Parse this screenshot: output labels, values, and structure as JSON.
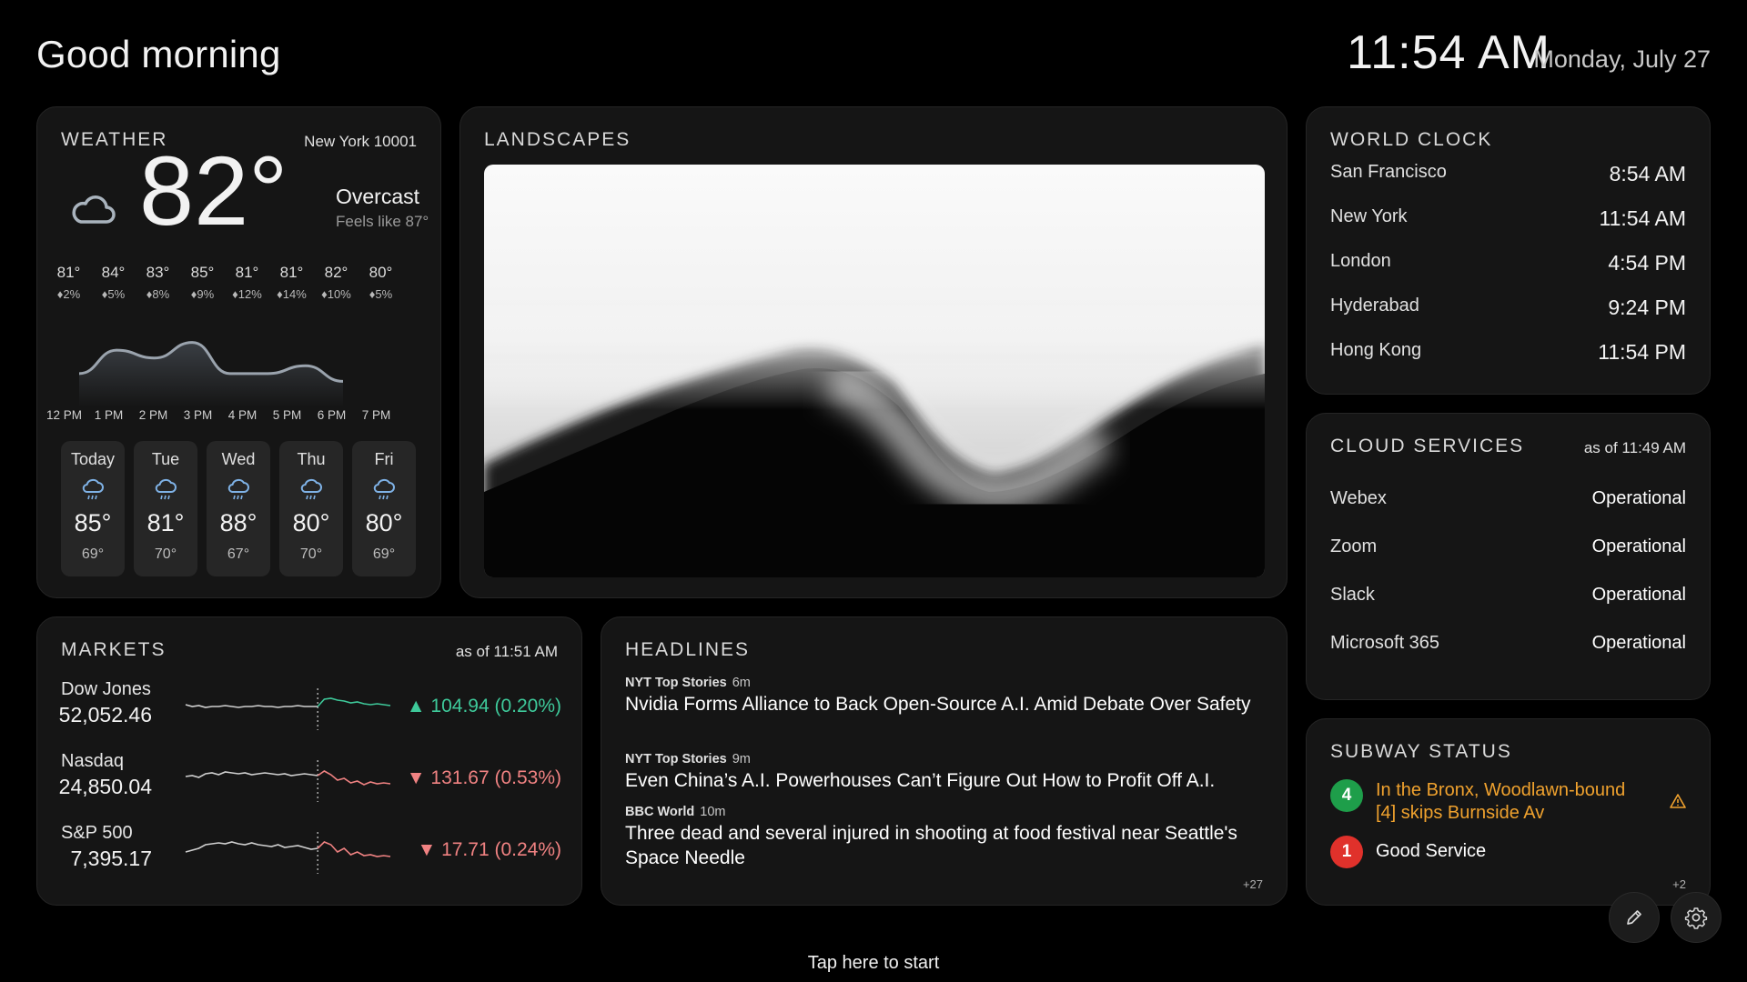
{
  "header": {
    "greeting": "Good morning",
    "time": "11:54 AM",
    "date": "Monday, July 27"
  },
  "weather": {
    "title": "WEATHER",
    "location": "New York 10001",
    "temp": "82°",
    "condition": "Overcast",
    "feels_like": "Feels like 87°",
    "icon": "cloud-icon",
    "hourly": [
      {
        "temp": "81°",
        "precip": "♦2%"
      },
      {
        "temp": "84°",
        "precip": "♦5%"
      },
      {
        "temp": "83°",
        "precip": "♦8%"
      },
      {
        "temp": "85°",
        "precip": "♦9%"
      },
      {
        "temp": "81°",
        "precip": "♦12%"
      },
      {
        "temp": "81°",
        "precip": "♦14%"
      },
      {
        "temp": "82°",
        "precip": "♦10%"
      },
      {
        "temp": "80°",
        "precip": "♦5%"
      }
    ],
    "hour_labels": [
      "12 PM",
      "1 PM",
      "2 PM",
      "3 PM",
      "4 PM",
      "5 PM",
      "6 PM",
      "7 PM"
    ],
    "daily": [
      {
        "name": "Today",
        "hi": "85°",
        "lo": "69°",
        "icon": "rain-icon"
      },
      {
        "name": "Tue",
        "hi": "81°",
        "lo": "70°",
        "icon": "rain-icon"
      },
      {
        "name": "Wed",
        "hi": "88°",
        "lo": "67°",
        "icon": "rain-icon"
      },
      {
        "name": "Thu",
        "hi": "80°",
        "lo": "70°",
        "icon": "rain-icon"
      },
      {
        "name": "Fri",
        "hi": "80°",
        "lo": "69°",
        "icon": "rain-icon"
      }
    ]
  },
  "landscapes": {
    "title": "LANDSCAPES"
  },
  "world_clock": {
    "title": "WORLD CLOCK",
    "cities": [
      {
        "city": "San Francisco",
        "time": "8:54 AM"
      },
      {
        "city": "New York",
        "time": "11:54 AM"
      },
      {
        "city": "London",
        "time": "4:54 PM"
      },
      {
        "city": "Hyderabad",
        "time": "9:24 PM"
      },
      {
        "city": "Hong Kong",
        "time": "11:54 PM"
      }
    ]
  },
  "cloud_services": {
    "title": "CLOUD SERVICES",
    "as_of": "as of 11:49 AM",
    "services": [
      {
        "name": "Webex",
        "status": "Operational"
      },
      {
        "name": "Zoom",
        "status": "Operational"
      },
      {
        "name": "Slack",
        "status": "Operational"
      },
      {
        "name": "Microsoft 365",
        "status": "Operational"
      }
    ]
  },
  "subway": {
    "title": "SUBWAY STATUS",
    "lines": [
      {
        "line": "4",
        "color": "#1e9e4a",
        "text_color": "#f0a22e",
        "status": "In the Bronx, Woodlawn-bound [4] skips Burnside Av",
        "warning": true
      },
      {
        "line": "1",
        "color": "#e0312b",
        "text_color": "#ffffff",
        "status": "Good Service",
        "warning": false
      }
    ],
    "more": "+2"
  },
  "markets": {
    "title": "MARKETS",
    "as_of": "as of 11:51 AM",
    "items": [
      {
        "name": "Dow Jones",
        "value": "52,052.46",
        "change": "▲ 104.94 (0.20%)",
        "direction": "up"
      },
      {
        "name": "Nasdaq",
        "value": "24,850.04",
        "change": "▼ 131.67 (0.53%)",
        "direction": "down"
      },
      {
        "name": "S&P 500",
        "value": "7,395.17",
        "change": "▼ 17.71 (0.24%)",
        "direction": "down"
      }
    ]
  },
  "headlines": {
    "title": "HEADLINES",
    "items": [
      {
        "source": "NYT Top Stories",
        "age": "6m",
        "title": "Nvidia Forms Alliance to Back Open-Source A.I. Amid Debate Over Safety"
      },
      {
        "source": "NYT Top Stories",
        "age": "9m",
        "title": "Even China’s A.I. Powerhouses Can’t Figure Out How to Profit Off A.I."
      },
      {
        "source": "BBC World",
        "age": "10m",
        "title": "Three dead and several injured in shooting at food festival near Seattle's Space Needle"
      }
    ],
    "more": "+27"
  },
  "footer": {
    "tap_prompt": "Tap here to start"
  },
  "colors": {
    "up": "#3ec99a",
    "down": "#f08282",
    "rain_icon": "#7fb2e6"
  }
}
